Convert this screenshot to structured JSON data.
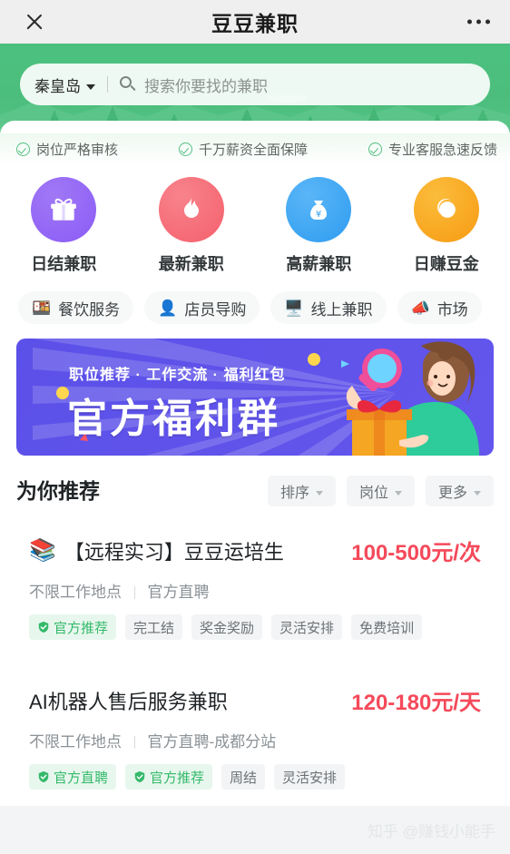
{
  "topbar": {
    "title": "豆豆兼职",
    "close_icon": "close-icon",
    "more_icon": "more-options-icon"
  },
  "search": {
    "city": "秦皇岛",
    "placeholder": "搜索你要找的兼职",
    "search_icon": "search-icon",
    "caret_icon": "chevron-down-icon"
  },
  "assurances": [
    {
      "label": "岗位严格审核",
      "icon": "check-circle-icon"
    },
    {
      "label": "千万薪资全面保障",
      "icon": "check-circle-icon"
    },
    {
      "label": "专业客服急速反馈",
      "icon": "check-circle-icon"
    }
  ],
  "categories": [
    {
      "label": "日结兼职",
      "icon": "gift-icon",
      "glyph": "🎁",
      "color": "#8b5cf6",
      "color2": "#a078f5"
    },
    {
      "label": "最新兼职",
      "icon": "flame-icon",
      "glyph": "🔥",
      "color": "#f4606c",
      "color2": "#f8838c"
    },
    {
      "label": "高薪兼职",
      "icon": "money-bag-icon",
      "glyph": "💰",
      "color": "#2f9cf0",
      "color2": "#5ab6f7"
    },
    {
      "label": "日赚豆金",
      "icon": "coin-icon",
      "glyph": "🪙",
      "color": "#f79a12",
      "color2": "#fbbd3c"
    }
  ],
  "chips": [
    {
      "label": "餐饮服务",
      "icon": "food-icon",
      "glyph": "🍱",
      "color": "#f5a623"
    },
    {
      "label": "店员导购",
      "icon": "person-icon",
      "glyph": "👤",
      "color": "#5aa9e6"
    },
    {
      "label": "线上兼职",
      "icon": "monitor-icon",
      "glyph": "🖥",
      "color": "#f05a28"
    },
    {
      "label": "市场",
      "icon": "megaphone-icon",
      "glyph": "📣",
      "color": "#34c06f"
    }
  ],
  "banner": {
    "subtitle": "职位推荐 · 工作交流 · 福利红包",
    "title": "官方福利群"
  },
  "recommend": {
    "title": "为你推荐",
    "filters": [
      {
        "label": "排序",
        "icon": "chevron-down-icon"
      },
      {
        "label": "岗位",
        "icon": "chevron-down-icon"
      },
      {
        "label": "更多",
        "icon": "chevron-down-icon"
      }
    ]
  },
  "jobs": [
    {
      "emoji": "📚",
      "emoji_icon": "books-icon",
      "title": "【远程实习】豆豆运培生",
      "price": "100-500元/次",
      "location": "不限工作地点",
      "source": "官方直聘",
      "tags": [
        {
          "label": "官方推荐",
          "green": true,
          "icon": "shield-check-icon"
        },
        {
          "label": "完工结",
          "green": false
        },
        {
          "label": "奖金奖励",
          "green": false
        },
        {
          "label": "灵活安排",
          "green": false
        },
        {
          "label": "免费培训",
          "green": false
        }
      ]
    },
    {
      "emoji": "",
      "emoji_icon": "",
      "title": "AI机器人售后服务兼职",
      "price": "120-180元/天",
      "location": "不限工作地点",
      "source": "官方直聘-成都分站",
      "tags": [
        {
          "label": "官方直聘",
          "green": true,
          "icon": "shield-check-icon"
        },
        {
          "label": "官方推荐",
          "green": true,
          "icon": "shield-check-icon"
        },
        {
          "label": "周结",
          "green": false
        },
        {
          "label": "灵活安排",
          "green": false
        }
      ]
    }
  ],
  "watermark": "知乎 @赚钱小能手",
  "colors": {
    "brand_green": "#4cbd7c",
    "price_red": "#f5495a",
    "tag_green": "#34b96a",
    "banner_purple": "#5b50e8"
  }
}
